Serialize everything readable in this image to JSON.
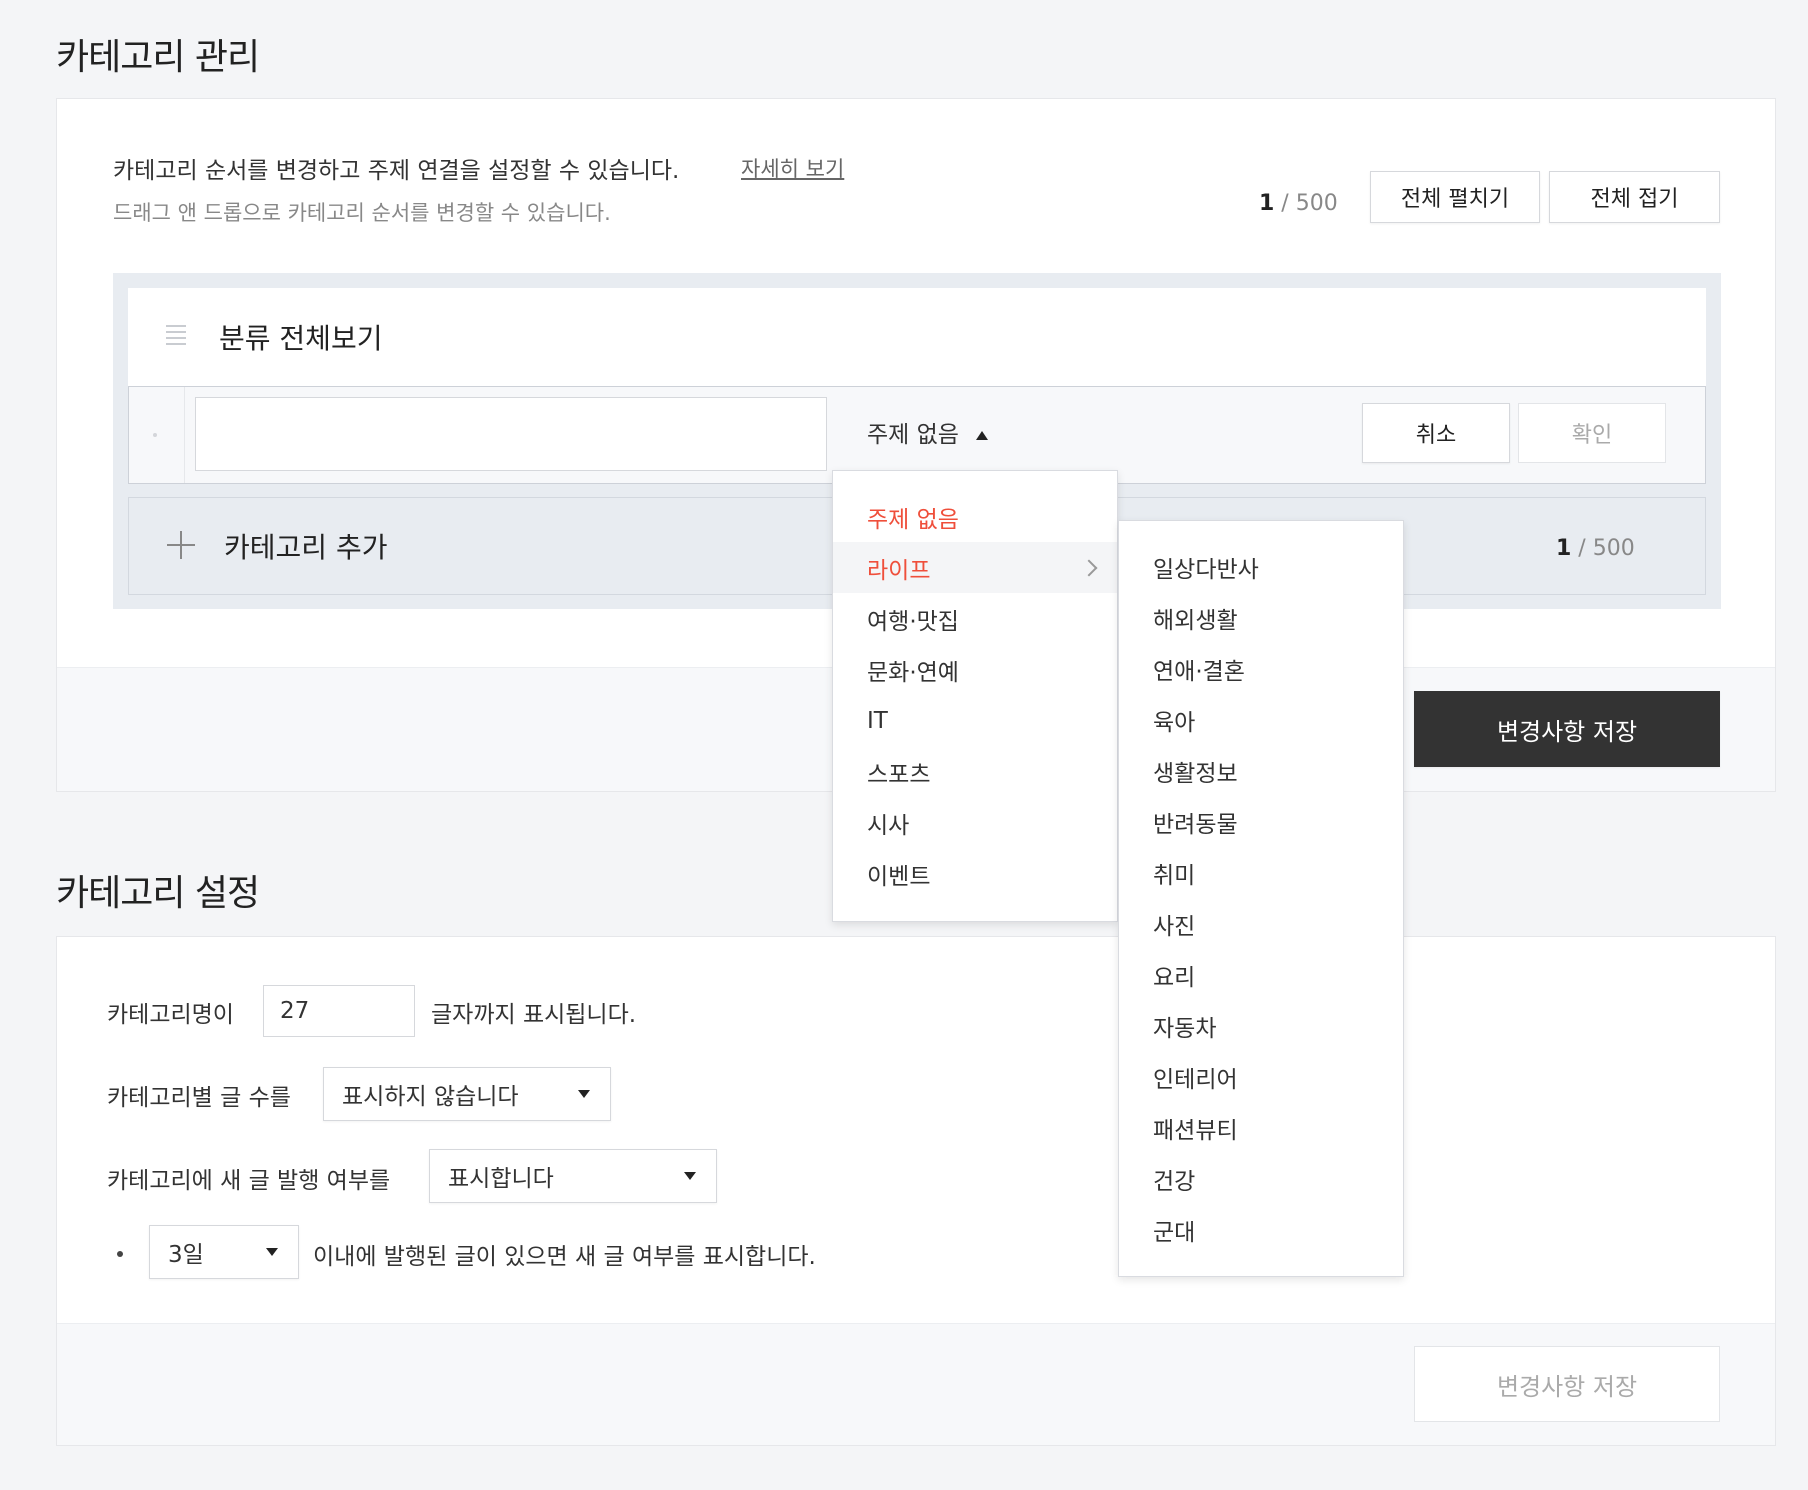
{
  "management": {
    "title": "카테고리 관리",
    "description": "카테고리 순서를 변경하고 주제 연결을 설정할 수 있습니다.",
    "detail_link": "자세히 보기",
    "sub_description": "드래그 앤 드롭으로 카테고리 순서를 변경할 수 있습니다.",
    "count_current": "1",
    "count_total": " / 500",
    "expand_all": "전체 펼치기",
    "collapse_all": "전체 접기",
    "root_label": "분류 전체보기",
    "edit_row": {
      "name_value": "",
      "topic_selected": "주제 없음",
      "cancel": "취소",
      "confirm": "확인"
    },
    "add_category": "카테고리 추가",
    "add_count_current": "1",
    "add_count_total": " / 500",
    "save": "변경사항 저장"
  },
  "topic_menu": {
    "items": [
      "주제 없음",
      "라이프",
      "여행·맛집",
      "문화·연예",
      "IT",
      "스포츠",
      "시사",
      "이벤트"
    ],
    "selected_index": 0,
    "hover_index": 1
  },
  "life_submenu": {
    "items": [
      "일상다반사",
      "해외생활",
      "연애·결혼",
      "육아",
      "생활정보",
      "반려동물",
      "취미",
      "사진",
      "요리",
      "자동차",
      "인테리어",
      "패션뷰티",
      "건강",
      "군대"
    ]
  },
  "settings": {
    "title": "카테고리 설정",
    "row1_prefix": "카테고리명이",
    "row1_value": "27",
    "row1_suffix": "글자까지 표시됩니다.",
    "row2_prefix": "카테고리별 글 수를",
    "row2_value": "표시하지 않습니다",
    "row3_prefix": "카테고리에 새 글 발행 여부를",
    "row3_value": "표시합니다",
    "row4_value": "3일",
    "row4_suffix": "이내에 발행된 글이 있으면 새 글 여부를 표시합니다.",
    "save": "변경사항 저장"
  }
}
